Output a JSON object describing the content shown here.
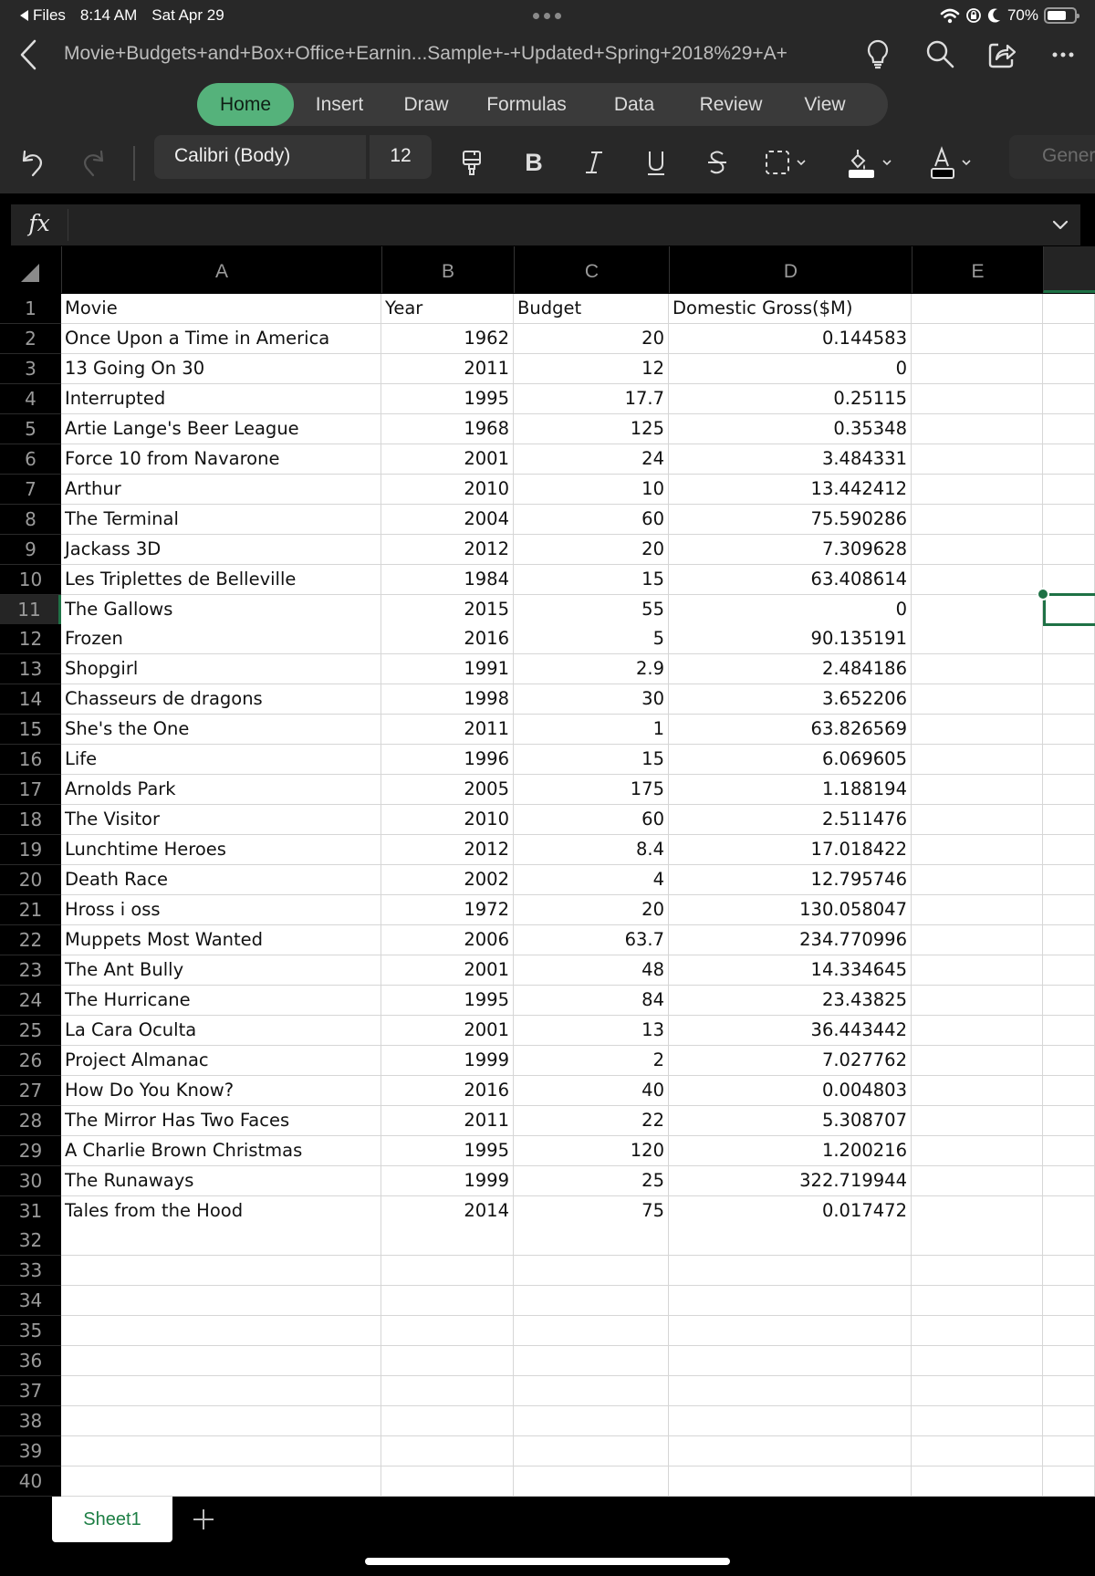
{
  "status_bar": {
    "back_app": "Files",
    "time": "8:14 AM",
    "date": "Sat Apr 29",
    "battery": "70%",
    "battery_level": 0.7
  },
  "title_bar": {
    "document_title": "Movie+Budgets+and+Box+Office+Earnin...Sample+-+Updated+Spring+2018%29+A+"
  },
  "ribbon": {
    "tabs": [
      {
        "label": "Home",
        "active": true
      },
      {
        "label": "Insert",
        "active": false
      },
      {
        "label": "Draw",
        "active": false
      },
      {
        "label": "Formulas",
        "active": false
      },
      {
        "label": "Data",
        "active": false
      },
      {
        "label": "Review",
        "active": false
      },
      {
        "label": "View",
        "active": false
      }
    ]
  },
  "toolbar": {
    "font_name": "Calibri (Body)",
    "font_size": "12",
    "number_format": "General",
    "icons": [
      "undo-icon",
      "redo-icon",
      "format-painter-icon",
      "bold-icon",
      "italic-icon",
      "underline-icon",
      "strikethrough-icon",
      "borders-icon",
      "fill-color-icon",
      "font-color-icon"
    ]
  },
  "formula_bar": {
    "fx_label": "fx",
    "value": ""
  },
  "grid": {
    "columns": [
      "A",
      "B",
      "C",
      "D",
      "E"
    ],
    "selected_column": "F",
    "selected_row": 11,
    "row_count": 40,
    "header_row": [
      "Movie",
      "Year",
      "Budget",
      "Domestic Gross($M)"
    ],
    "rows": [
      [
        "Once Upon a Time in America",
        "1962",
        "20",
        "0.144583"
      ],
      [
        "13 Going On 30",
        "2011",
        "12",
        "0"
      ],
      [
        "Interrupted",
        "1995",
        "17.7",
        "0.25115"
      ],
      [
        "Artie Lange's Beer League",
        "1968",
        "125",
        "0.35348"
      ],
      [
        "Force 10 from Navarone",
        "2001",
        "24",
        "3.484331"
      ],
      [
        "Arthur",
        "2010",
        "10",
        "13.442412"
      ],
      [
        "The Terminal",
        "2004",
        "60",
        "75.590286"
      ],
      [
        "Jackass 3D",
        "2012",
        "20",
        "7.309628"
      ],
      [
        "Les Triplettes de Belleville",
        "1984",
        "15",
        "63.408614"
      ],
      [
        "The Gallows",
        "2015",
        "55",
        "0"
      ],
      [
        "Frozen",
        "2016",
        "5",
        "90.135191"
      ],
      [
        "Shopgirl",
        "1991",
        "2.9",
        "2.484186"
      ],
      [
        "Chasseurs de dragons",
        "1998",
        "30",
        "3.652206"
      ],
      [
        "She's the One",
        "2011",
        "1",
        "63.826569"
      ],
      [
        "Life",
        "1996",
        "15",
        "6.069605"
      ],
      [
        "Arnolds Park",
        "2005",
        "175",
        "1.188194"
      ],
      [
        "The Visitor",
        "2010",
        "60",
        "2.511476"
      ],
      [
        "Lunchtime Heroes",
        "2012",
        "8.4",
        "17.018422"
      ],
      [
        "Death Race",
        "2002",
        "4",
        "12.795746"
      ],
      [
        "Hross i oss",
        "1972",
        "20",
        "130.058047"
      ],
      [
        "Muppets Most Wanted",
        "2006",
        "63.7",
        "234.770996"
      ],
      [
        "The Ant Bully",
        "2001",
        "48",
        "14.334645"
      ],
      [
        "The Hurricane",
        "1995",
        "84",
        "23.43825"
      ],
      [
        "La Cara Oculta",
        "2001",
        "13",
        "36.443442"
      ],
      [
        "Project Almanac",
        "1999",
        "2",
        "7.027762"
      ],
      [
        "How Do You Know?",
        "2016",
        "40",
        "0.004803"
      ],
      [
        "The Mirror Has Two Faces",
        "2011",
        "22",
        "5.308707"
      ],
      [
        "A Charlie Brown Christmas",
        "1995",
        "120",
        "1.200216"
      ],
      [
        "The Runaways",
        "1999",
        "25",
        "322.719944"
      ],
      [
        "Tales from the Hood",
        "2014",
        "75",
        "0.017472"
      ]
    ]
  },
  "sheets": {
    "tabs": [
      "Sheet1"
    ],
    "active": "Sheet1",
    "add_label": "+"
  },
  "colors": {
    "accent": "#1e7145",
    "ribbon_active": "#55b27b",
    "sheet_tab_text": "#1e7f45"
  }
}
